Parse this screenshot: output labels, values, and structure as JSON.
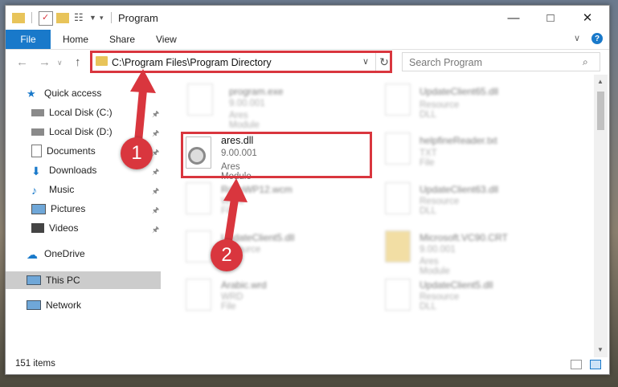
{
  "window": {
    "title": "Program"
  },
  "ribbon": {
    "file": "File",
    "tabs": [
      "Home",
      "Share",
      "View"
    ],
    "help": "?"
  },
  "address": {
    "path": "C:\\Program Files\\Program Directory"
  },
  "search": {
    "placeholder": "Search Program"
  },
  "nav": {
    "quick_access": "Quick access",
    "items": [
      "Local Disk (C:)",
      "Local Disk (D:)",
      "Documents",
      "Downloads",
      "Music",
      "Pictures",
      "Videos"
    ],
    "onedrive": "OneDrive",
    "this_pc": "This PC",
    "network": "Network"
  },
  "files": [
    {
      "name": "program.exe",
      "line2": "9.00.001",
      "line3": "Ares Module"
    },
    {
      "name": "UpdateClient65.dll",
      "line2": "Resource DLL"
    },
    {
      "name": "ares.dll",
      "line2": "9.00.001",
      "line3": "Ares Module"
    },
    {
      "name": "helpfineReader.txt",
      "line2": "TXT File"
    },
    {
      "name": "RdToWP12.wcm",
      "line2": "WCM File"
    },
    {
      "name": "UpdateClient63.dll",
      "line2": "Resource DLL"
    },
    {
      "name": "UpdateClient5.dll",
      "line2": "Resource DLL"
    },
    {
      "name": "Microsoft.VC90.CRT",
      "line2": "9.00.001",
      "line3": "Ares Module"
    },
    {
      "name": "Arabic.wrd",
      "line2": "WRD File"
    },
    {
      "name": "UpdateClient5.dll",
      "line2": "Resource DLL"
    }
  ],
  "status": {
    "count": "151 items"
  },
  "callouts": [
    "1",
    "2"
  ],
  "colors": {
    "accent": "#1979ca",
    "highlight": "#d9363e",
    "folder": "#e8c45a"
  }
}
